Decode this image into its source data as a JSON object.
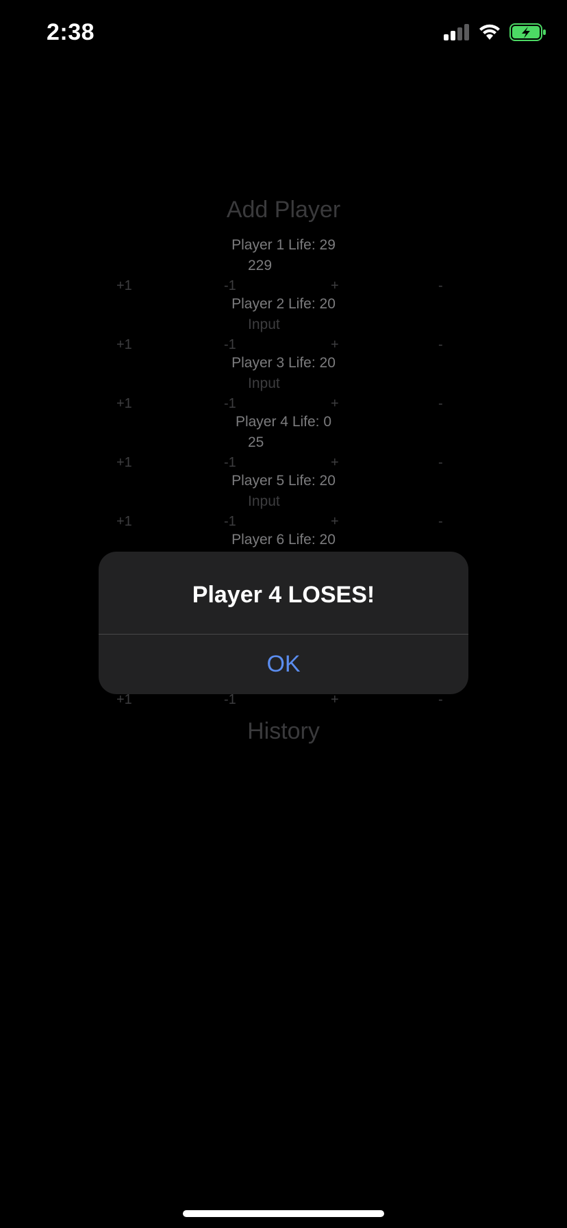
{
  "status_bar": {
    "time": "2:38",
    "icons": [
      "cellular-signal-icon",
      "wifi-icon",
      "battery-charging-icon"
    ],
    "battery_color": "#4cd964"
  },
  "app": {
    "add_player_label": "Add Player",
    "history_label": "History",
    "controls": {
      "plus_one": "+1",
      "minus_one": "-1",
      "plus": "+",
      "minus": "-"
    },
    "players": [
      {
        "life_label": "Player 1 Life: 29",
        "input_value": "229",
        "input_placeholder": "Input"
      },
      {
        "life_label": "Player 2 Life: 20",
        "input_value": "",
        "input_placeholder": "Input"
      },
      {
        "life_label": "Player 3 Life: 20",
        "input_value": "",
        "input_placeholder": "Input"
      },
      {
        "life_label": "Player 4 Life: 0",
        "input_value": "25",
        "input_placeholder": "Input"
      },
      {
        "life_label": "Player 5 Life: 20",
        "input_value": "",
        "input_placeholder": "Input"
      },
      {
        "life_label": "Player 6 Life: 20",
        "input_value": "",
        "input_placeholder": "Input"
      }
    ]
  },
  "alert": {
    "title": "Player 4 LOSES!",
    "ok_label": "OK",
    "ok_color": "#5b8def"
  }
}
